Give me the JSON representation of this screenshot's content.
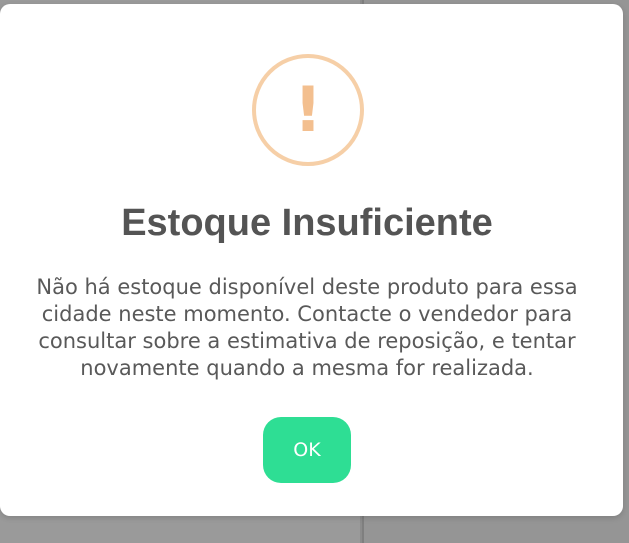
{
  "dialog": {
    "icon": "warning-exclamation-icon",
    "icon_glyph": "!",
    "title": "Estoque Insuficiente",
    "message": "Não há estoque disponível deste produto para essa cidade neste momento. Contacte o vendedor para consultar sobre a estimativa de reposição, e tentar novamente quando a mesma for realizada.",
    "ok_label": "OK"
  },
  "colors": {
    "backdrop": "#8c8c8c",
    "modal_bg": "#ffffff",
    "icon_ring": "#f6cfa7",
    "icon_glyph": "#f3bf8f",
    "title": "#545454",
    "message": "#595959",
    "ok_button": "#2ede94"
  }
}
